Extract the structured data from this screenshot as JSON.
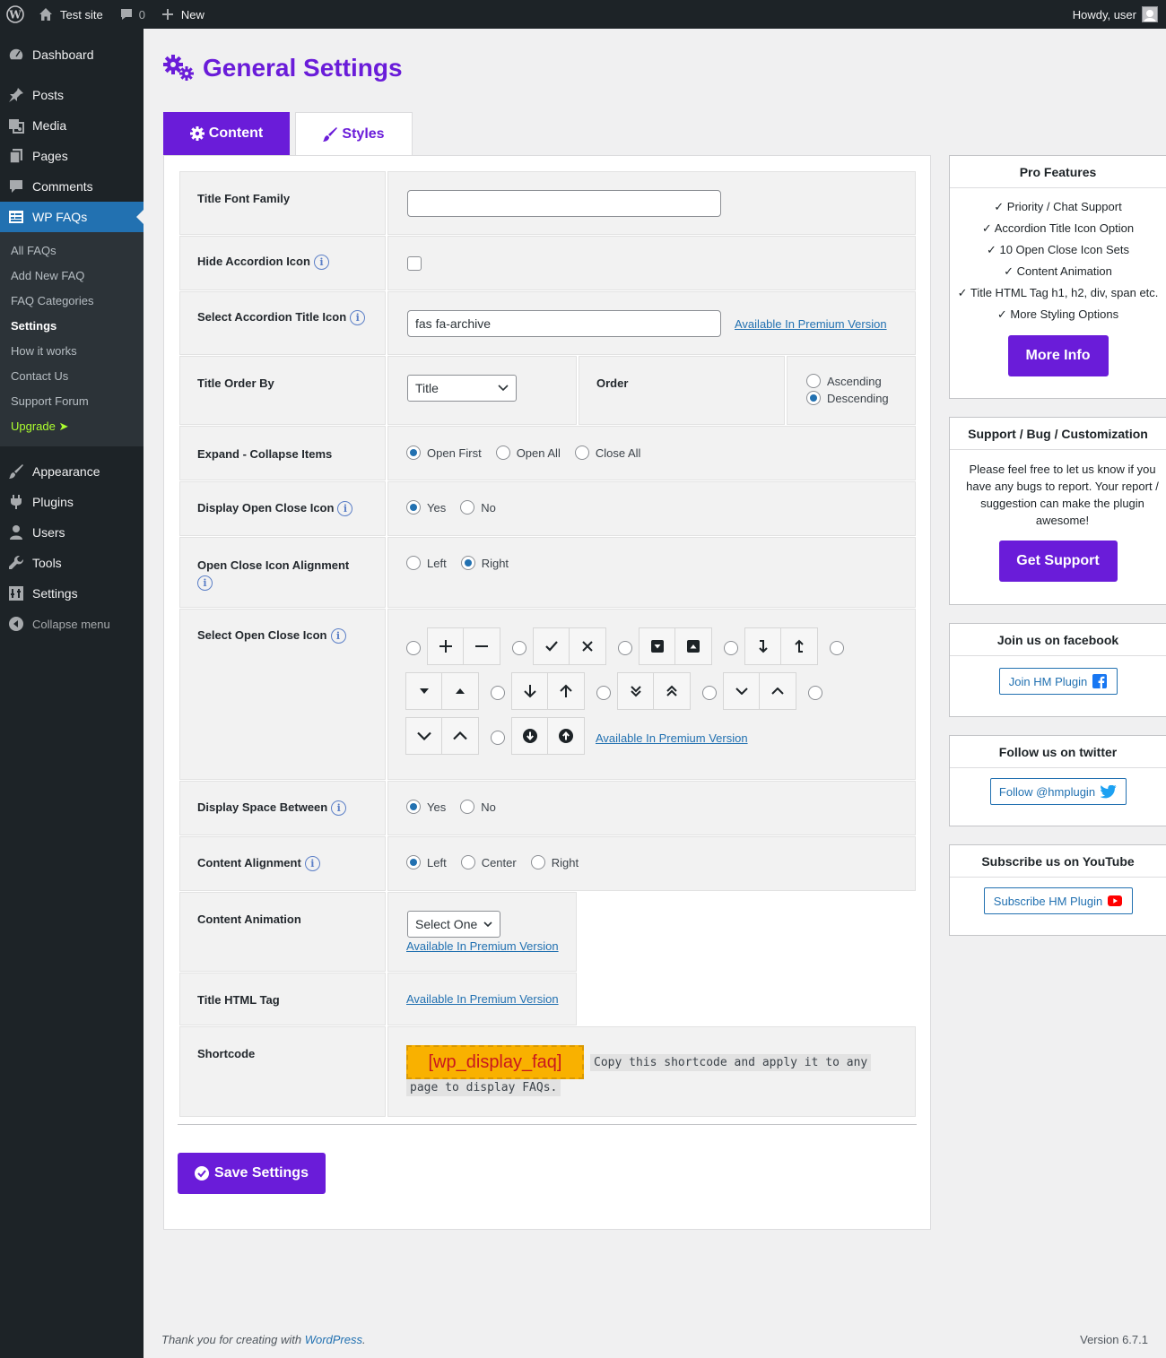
{
  "adminbar": {
    "site_name": "Test site",
    "comments_count": "0",
    "new_label": "New",
    "howdy": "Howdy, user"
  },
  "sidebar": {
    "items_top": [
      {
        "label": "Dashboard",
        "icon": "dashboard-icon"
      },
      {
        "label": "Posts",
        "icon": "pin-icon"
      },
      {
        "label": "Media",
        "icon": "media-icon"
      },
      {
        "label": "Pages",
        "icon": "pages-icon"
      },
      {
        "label": "Comments",
        "icon": "comment-icon"
      },
      {
        "label": "WP FAQs",
        "icon": "faq-icon"
      }
    ],
    "submenu": [
      "All FAQs",
      "Add New FAQ",
      "FAQ Categories",
      "Settings",
      "How it works",
      "Contact Us",
      "Support Forum",
      "Upgrade ➤"
    ],
    "items_bottom": [
      {
        "label": "Appearance",
        "icon": "brush-icon"
      },
      {
        "label": "Plugins",
        "icon": "plugin-icon"
      },
      {
        "label": "Users",
        "icon": "user-icon"
      },
      {
        "label": "Tools",
        "icon": "wrench-icon"
      },
      {
        "label": "Settings",
        "icon": "settings-icon"
      }
    ],
    "collapse": "Collapse menu"
  },
  "page": {
    "title": "General Settings",
    "tab_content": "Content",
    "tab_styles": "Styles"
  },
  "form": {
    "title_font_family": {
      "label": "Title Font Family",
      "value": ""
    },
    "hide_icon": {
      "label": "Hide Accordion Icon"
    },
    "title_icon": {
      "label": "Select Accordion Title Icon",
      "value": "fas fa-archive"
    },
    "premium": "Available In Premium Version",
    "order_by": {
      "label": "Title Order By",
      "value": "Title",
      "order_label": "Order",
      "asc": "Ascending",
      "desc": "Descending"
    },
    "expand": {
      "label": "Expand - Collapse Items",
      "opt1": "Open First",
      "opt2": "Open All",
      "opt3": "Close All"
    },
    "display_icon": {
      "label": "Display Open Close Icon",
      "yes": "Yes",
      "no": "No"
    },
    "icon_align": {
      "label": "Open Close Icon Alignment",
      "left": "Left",
      "right": "Right"
    },
    "select_icon": {
      "label": "Select Open Close Icon"
    },
    "space_between": {
      "label": "Display Space Between",
      "yes": "Yes",
      "no": "No"
    },
    "content_align": {
      "label": "Content Alignment",
      "left": "Left",
      "center": "Center",
      "right": "Right"
    },
    "animation": {
      "label": "Content Animation",
      "value": "Select One"
    },
    "html_tag": {
      "label": "Title HTML Tag"
    },
    "shortcode": {
      "label": "Shortcode",
      "code": "[wp_display_faq]",
      "note1": "Copy this shortcode and apply it to any",
      "note2": "page to display FAQs."
    },
    "save": "Save Settings"
  },
  "panels": {
    "pro": {
      "title": "Pro Features",
      "features": [
        "✓ Priority / Chat Support",
        "✓ Accordion Title Icon Option",
        "✓ 10 Open Close Icon Sets",
        "✓ Content Animation",
        "✓ Title HTML Tag h1, h2, div, span etc.",
        "✓ More Styling Options"
      ],
      "button": "More Info"
    },
    "support": {
      "title": "Support / Bug / Customization",
      "text": "Please feel free to let us know if you have any bugs to report. Your report / suggestion can make the plugin awesome!",
      "button": "Get Support"
    },
    "facebook": {
      "title": "Join us on facebook",
      "button": "Join HM Plugin"
    },
    "twitter": {
      "title": "Follow us on twitter",
      "button": "Follow @hmplugin"
    },
    "youtube": {
      "title": "Subscribe us on YouTube",
      "button": "Subscribe HM Plugin"
    }
  },
  "footer": {
    "thanks": "Thank you for creating with ",
    "wp": "WordPress",
    "dot": ".",
    "version": "Version 6.7.1"
  },
  "colors": {
    "accent": "#6a1cd9",
    "admin_bg": "#1d2327",
    "link": "#2271b1"
  }
}
